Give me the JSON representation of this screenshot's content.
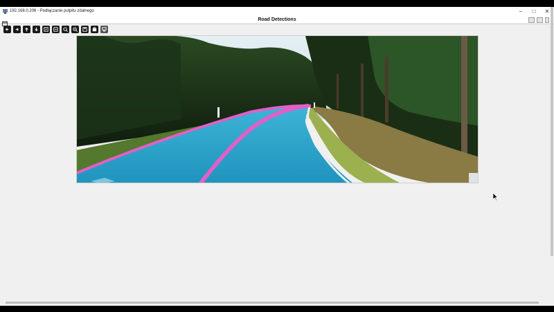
{
  "rdp_window": {
    "title": "192.168.0.206 - Podłączanie pulpitu zdalnego",
    "icon": "remote-desktop-icon",
    "controls": [
      "minimize",
      "maximize",
      "close"
    ]
  },
  "app_window": {
    "title": "Road Detections",
    "toolbar": [
      {
        "name": "pan-left-button",
        "icon": "arrow-left-icon"
      },
      {
        "name": "pan-right-button",
        "icon": "arrow-right-icon"
      },
      {
        "name": "pan-up-button",
        "icon": "arrow-up-icon"
      },
      {
        "name": "pan-down-button",
        "icon": "arrow-down-icon"
      },
      {
        "name": "zoom-in-button",
        "icon": "zoom-in-icon"
      },
      {
        "name": "zoom-out-button",
        "icon": "zoom-out-icon"
      },
      {
        "name": "zoom-fit-button",
        "icon": "magnifier-icon"
      },
      {
        "name": "zoom-reset-button",
        "icon": "magnifier-minus-icon"
      },
      {
        "name": "save-image-button",
        "icon": "save-icon"
      },
      {
        "name": "copy-image-button",
        "icon": "copy-icon"
      },
      {
        "name": "properties-button",
        "icon": "properties-icon"
      }
    ],
    "image": {
      "content": "road-detection-overlay",
      "colors": {
        "road_mask": "#2aa6c9",
        "lane_lines": "#e060c8",
        "sky": "#cfe4ef",
        "trees": "#1f3a1d",
        "grass": "#7a9a3c"
      }
    }
  }
}
